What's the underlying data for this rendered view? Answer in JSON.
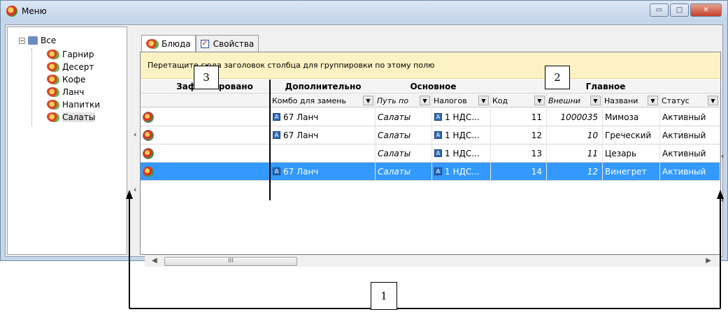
{
  "window": {
    "title": "Меню",
    "buttons": {
      "minimize": "▭",
      "maximize": "□",
      "close": "✕"
    }
  },
  "tree": {
    "root": "Все",
    "items": [
      "Гарнир",
      "Десерт",
      "Кофе",
      "Ланч",
      "Напитки",
      "Салаты"
    ],
    "selected": "Салаты"
  },
  "tabs": [
    {
      "label": "Блюда",
      "active": true
    },
    {
      "label": "Свойства",
      "active": false
    }
  ],
  "grid": {
    "group_panel_text": "Перетащите сюда заголовок столбца для группировки по этому полю",
    "bands": [
      "Зафиксировано",
      "Дополнительно",
      "Основное",
      "Главное"
    ],
    "columns": [
      "Комбо для замень",
      "Путь по",
      "Налогов",
      "Код",
      "Внешни",
      "Названи",
      "Статус"
    ],
    "rows": [
      {
        "combo": "67 Ланч",
        "path": "Салаты",
        "tax": "1 НДС...",
        "code": "11",
        "ext": "1000035",
        "name": "Мимоза",
        "status": "Активный",
        "selected": false
      },
      {
        "combo": "67 Ланч",
        "path": "Салаты",
        "tax": "1 НДС...",
        "code": "12",
        "ext": "10",
        "name": "Греческий",
        "status": "Активный",
        "selected": false
      },
      {
        "combo": "",
        "path": "Салаты",
        "tax": "1 НДС...",
        "code": "13",
        "ext": "11",
        "name": "Цезарь",
        "status": "Активный",
        "selected": false
      },
      {
        "combo": "67 Ланч",
        "path": "Салаты",
        "tax": "1 НДС...",
        "code": "14",
        "ext": "12",
        "name": "Винегрет",
        "status": "Активный",
        "selected": true
      }
    ],
    "scroll_thumb": "III"
  },
  "callouts": [
    "1",
    "2",
    "3"
  ],
  "colors": {
    "selection": "#3399ff",
    "group_panel": "#fdf2c3"
  }
}
